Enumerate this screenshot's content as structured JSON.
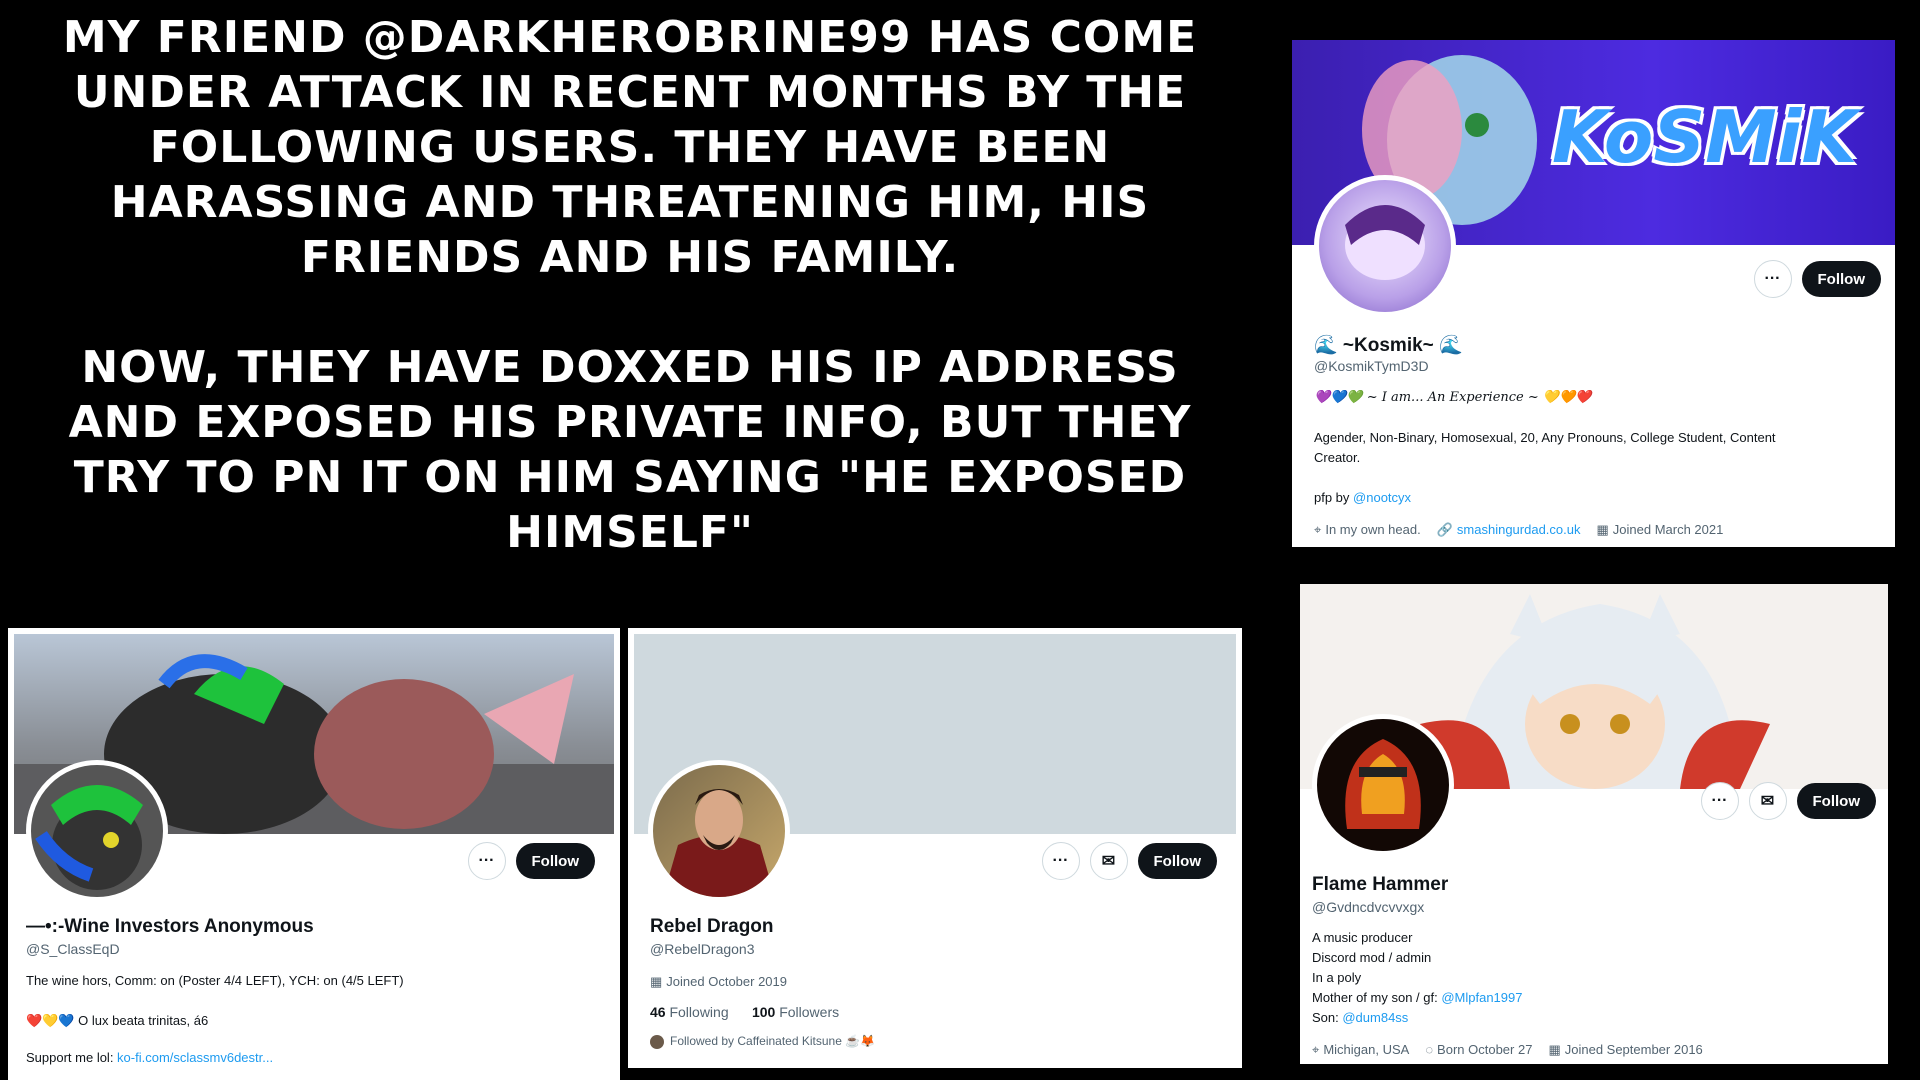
{
  "headline": {
    "paragraph1": "MY FRIEND @DARKHEROBRINE99 HAS COME UNDER ATTACK IN RECENT MONTHS BY THE FOLLOWING USERS. THEY HAVE BEEN HARASSING AND THREATENING HIM, HIS FRIENDS AND HIS FAMILY.",
    "paragraph2": "NOW, THEY HAVE DOXXED HIS IP ADDRESS AND EXPOSED HIS PRIVATE INFO, BUT THEY TRY TO PN IT ON HIM SAYING \"HE EXPOSED HIMSELF\""
  },
  "buttons": {
    "more": "···",
    "message": "✉",
    "follow": "Follow"
  },
  "kosmik": {
    "banner_text": "KoSMiK",
    "name": "🌊 ~Kosmik~ 🌊",
    "handle": "@KosmikTymD3D",
    "tagline": "💜💙💚 ~ I am... An Experience ~ 💛🧡❤️",
    "bio": "Agender, Non-Binary, Homosexual, 20, Any Pronouns, College Student, Content",
    "bio2": "Creator.",
    "pfp_label": "pfp by ",
    "pfp_link": "@nootcyx",
    "location": "In my own head.",
    "website": "smashingurdad.co.uk",
    "joined": "Joined March 2021"
  },
  "wine": {
    "name": "—•:-Wine Investors Anonymous",
    "handle": "@S_ClassEqD",
    "bio": "The wine hors, Comm: on (Poster 4/4 LEFT), YCH: on (4/5 LEFT)",
    "motto": "❤️💛💙 O lux beata trinitas, á6",
    "support_label": "Support me lol: ",
    "support_link": "ko-fi.com/sclassmv6destr..."
  },
  "rebel": {
    "name": "Rebel Dragon",
    "handle": "@RebelDragon3",
    "joined": "Joined October 2019",
    "following_count": "46",
    "following_label": "Following",
    "followers_count": "100",
    "followers_label": "Followers",
    "followed_by": "Followed by Caffeinated Kitsune ☕🦊"
  },
  "flame": {
    "name": "Flame Hammer",
    "handle": "@Gvdncdvcvvxgx",
    "bio1": "A music producer",
    "bio2": "Discord mod / admin",
    "bio3": "In a poly",
    "bio4_label": "Mother of my son / gf: ",
    "bio4_link": "@Mlpfan1997",
    "bio5_label": "Son: ",
    "bio5_link": "@dum84ss",
    "location": "Michigan, USA",
    "born": "Born October 27",
    "joined": "Joined September 2016"
  }
}
